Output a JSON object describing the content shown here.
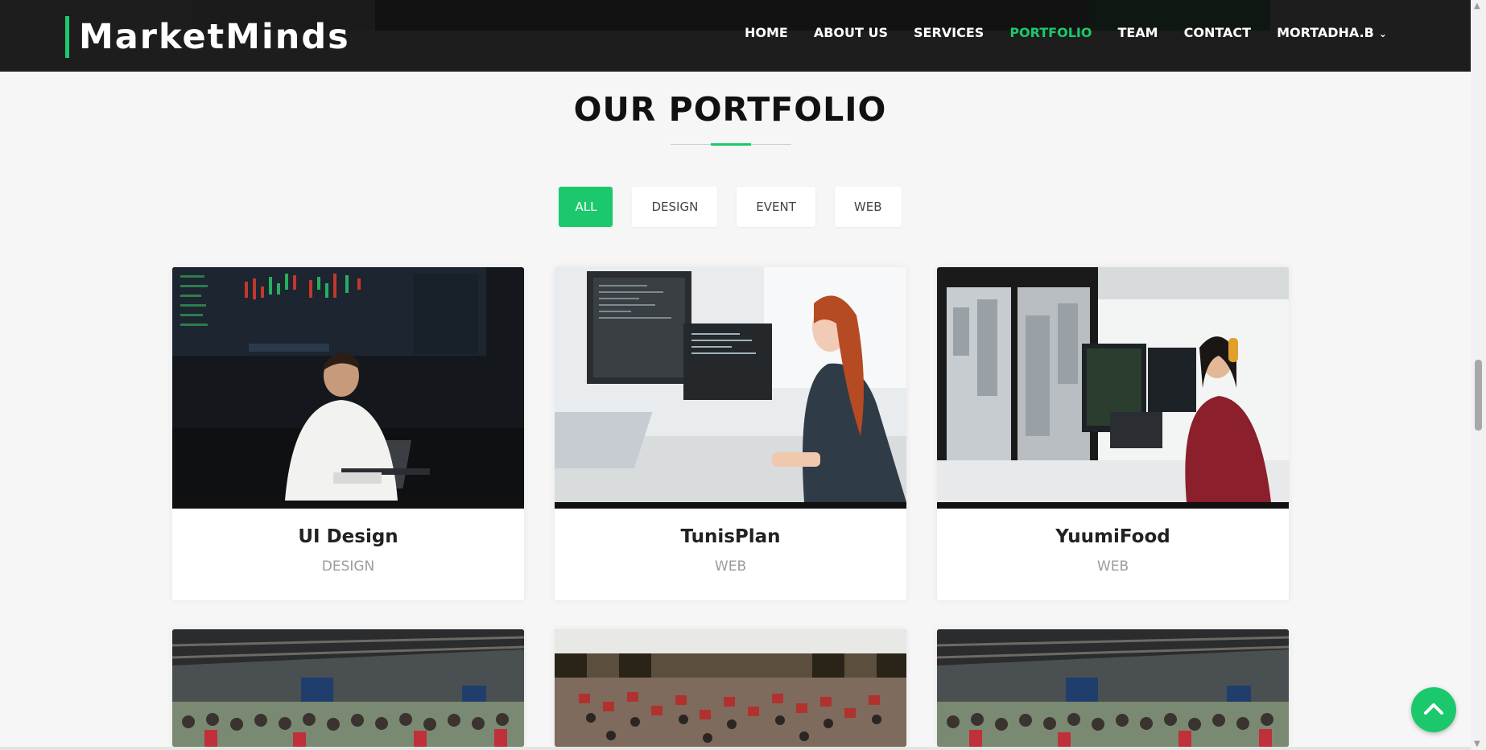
{
  "brand": {
    "name": "MarketMinds",
    "accent": "#1bc86b"
  },
  "nav": {
    "items": [
      {
        "label": "HOME",
        "active": false
      },
      {
        "label": "ABOUT US",
        "active": false
      },
      {
        "label": "SERVICES",
        "active": false
      },
      {
        "label": "PORTFOLIO",
        "active": true
      },
      {
        "label": "TEAM",
        "active": false
      },
      {
        "label": "CONTACT",
        "active": false
      },
      {
        "label": "MORTADHA.B",
        "active": false,
        "icon": "chevron-down-icon"
      }
    ]
  },
  "portfolio": {
    "title": "OUR PORTFOLIO",
    "filters": [
      {
        "label": "ALL",
        "active": true
      },
      {
        "label": "DESIGN",
        "active": false
      },
      {
        "label": "EVENT",
        "active": false
      },
      {
        "label": "WEB",
        "active": false
      }
    ],
    "items": [
      {
        "title": "UI Design",
        "category": "DESIGN"
      },
      {
        "title": "TunisPlan",
        "category": "WEB"
      },
      {
        "title": "YuumiFood",
        "category": "WEB"
      }
    ]
  },
  "back_to_top": {
    "icon": "chevron-up-icon"
  }
}
